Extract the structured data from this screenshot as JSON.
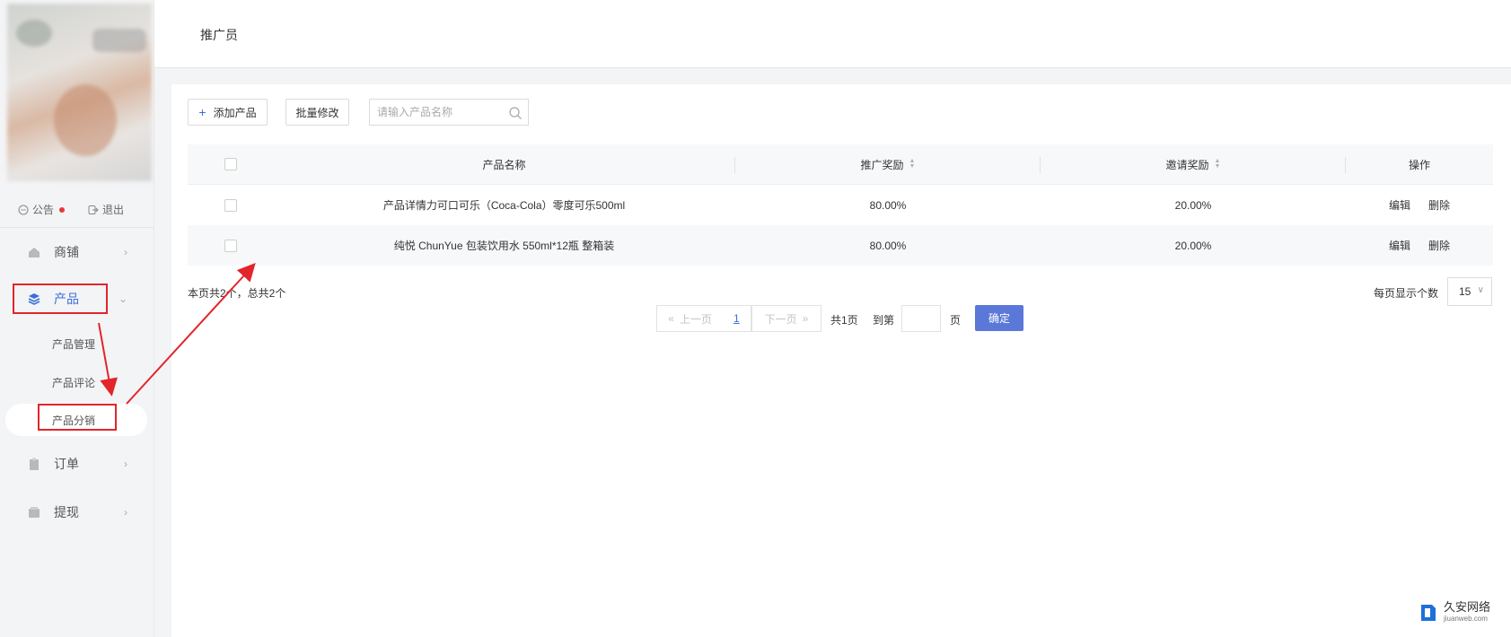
{
  "sidebar": {
    "notice": "公告",
    "logout": "退出",
    "nav": [
      {
        "label": "商铺"
      },
      {
        "label": "产品"
      },
      {
        "label": "订单"
      },
      {
        "label": "提现"
      }
    ],
    "product_sub": [
      "产品管理",
      "产品评论",
      "产品分销"
    ]
  },
  "header": {
    "title": "推广员"
  },
  "toolbar": {
    "add_label": "添加产品",
    "batch_label": "批量修改",
    "search_placeholder": "请输入产品名称"
  },
  "table": {
    "headers": {
      "name": "产品名称",
      "reward": "推广奖励",
      "invite": "邀请奖励",
      "op": "操作"
    },
    "rows": [
      {
        "name": "产品详情力可口可乐（Coca-Cola）零度可乐500ml",
        "reward": "80.00%",
        "invite": "20.00%",
        "edit": "编辑",
        "delete": "删除"
      },
      {
        "name": "纯悦 ChunYue 包装饮用水 550ml*12瓶 整箱装",
        "reward": "80.00%",
        "invite": "20.00%",
        "edit": "编辑",
        "delete": "删除"
      }
    ]
  },
  "footer": {
    "summary": "本页共2个，总共2个",
    "per_page_label": "每页显示个数",
    "per_page_value": "15"
  },
  "pagination": {
    "prev": "上一页",
    "current": "1",
    "next": "下一页",
    "total_pages": "共1页",
    "goto": "到第",
    "page_unit": "页",
    "confirm": "确定"
  },
  "watermark": {
    "cn": "久安网络",
    "en": "jiuanweb.com"
  },
  "colors": {
    "accent": "#3b6fd8",
    "confirm_button": "#5b78d9",
    "annotation_red": "#e3242b",
    "notice_dot": "#e53935"
  }
}
